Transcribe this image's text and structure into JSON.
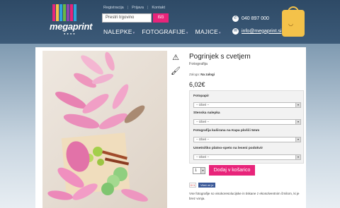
{
  "header": {
    "logo_text": "megaprint",
    "top_links": [
      "Registracija",
      "Prijava",
      "Kontakt"
    ],
    "search": {
      "placeholder": "Prestri trgovino",
      "button_label": "Išči"
    },
    "nav": [
      "NALEPKE",
      "FOTOGRAFIJE",
      "MAJICE"
    ],
    "contact": {
      "phone": "040 897 000",
      "email": "info@megaprint.si"
    },
    "brand_colors": [
      "#e8247a",
      "#f4c24a",
      "#2ea3dc",
      "#6bb845",
      "#8e44ad"
    ]
  },
  "product": {
    "title": "Pogrinjek s cvetjem",
    "category": "Fotografija",
    "stock_label": "Zaloga:",
    "stock_value": "Na zalogi",
    "price": "6,02€",
    "options": [
      {
        "label": "Fotopapir",
        "value": "-- Izberi --"
      },
      {
        "label": "Stenska nalepka",
        "value": "-- Izberi --"
      },
      {
        "label": "Fotografija kaširana na Kapa plošči 5mm",
        "value": "-- Izberi --"
      },
      {
        "label": "Umetniško platno-speto na leseni podokvir",
        "value": "-- Izberi --"
      }
    ],
    "quantity": "1",
    "add_to_cart_label": "Dodaj v košarico",
    "social": {
      "gplus": "0+1",
      "facebook": "Všeč mi je"
    },
    "description": "Vse fotografije so visokoresolucijske in tiskane z ekosolventnim črnilom, ki je brez vonja.",
    "tool_icons": [
      "warning-icon",
      "brush-icon"
    ]
  }
}
